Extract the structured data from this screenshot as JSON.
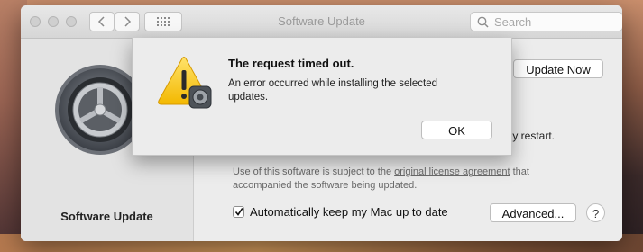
{
  "window": {
    "title": "Software Update",
    "search_placeholder": "Search"
  },
  "sidebar": {
    "title": "Software Update",
    "icon": "gear-icon"
  },
  "main": {
    "update_now_label": "Update Now",
    "restart_text": "lly restart.",
    "license_prefix": "Use of this software is subject to the ",
    "license_link": "original license agreement",
    "license_suffix": " that accompanied the software being updated.",
    "auto_update_label": "Automatically keep my Mac up to date",
    "auto_update_checked": true,
    "advanced_label": "Advanced...",
    "help_label": "?"
  },
  "alert": {
    "title": "The request timed out.",
    "message": "An error occurred while installing the selected updates.",
    "ok_label": "OK",
    "icon": "warning-icon"
  }
}
